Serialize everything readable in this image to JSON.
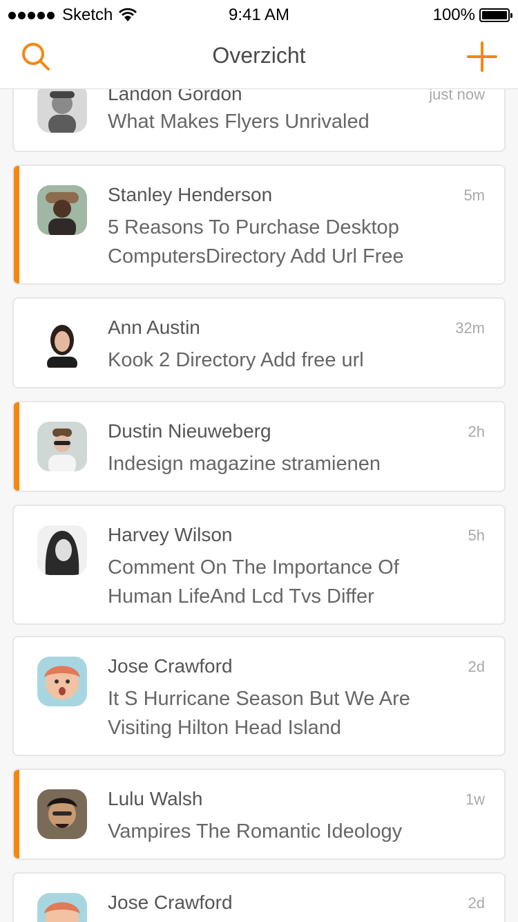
{
  "status_bar": {
    "carrier": "Sketch",
    "time": "9:41 AM",
    "battery": "100%"
  },
  "nav": {
    "title": "Overzicht",
    "left_icon": "search-icon",
    "right_icon": "plus-icon"
  },
  "colors": {
    "accent": "#f5870f",
    "unread_bar": "#f5870f"
  },
  "messages": [
    {
      "name": "Landon Gordon",
      "time": "just now",
      "text": "What Makes Flyers Unrivaled",
      "unread": false
    },
    {
      "name": "Stanley Henderson",
      "time": "5m",
      "text": "5 Reasons To Purchase Desktop ComputersDirectory Add Url Free",
      "unread": true
    },
    {
      "name": "Ann Austin",
      "time": "32m",
      "text": "Kook 2 Directory Add free url",
      "unread": false
    },
    {
      "name": "Dustin Nieuweberg",
      "time": "2h",
      "text": "Indesign magazine stramienen",
      "unread": true
    },
    {
      "name": "Harvey Wilson",
      "time": "5h",
      "text": "Comment On The Importance Of Human LifeAnd Lcd Tvs Differ",
      "unread": false
    },
    {
      "name": "Jose Crawford",
      "time": "2d",
      "text": "It S Hurricane Season But We Are Visiting Hilton Head Island",
      "unread": false
    },
    {
      "name": "Lulu Walsh",
      "time": "1w",
      "text": "Vampires The Romantic Ideology",
      "unread": true
    },
    {
      "name": "Jose Crawford",
      "time": "2d",
      "text": "",
      "unread": false
    }
  ]
}
